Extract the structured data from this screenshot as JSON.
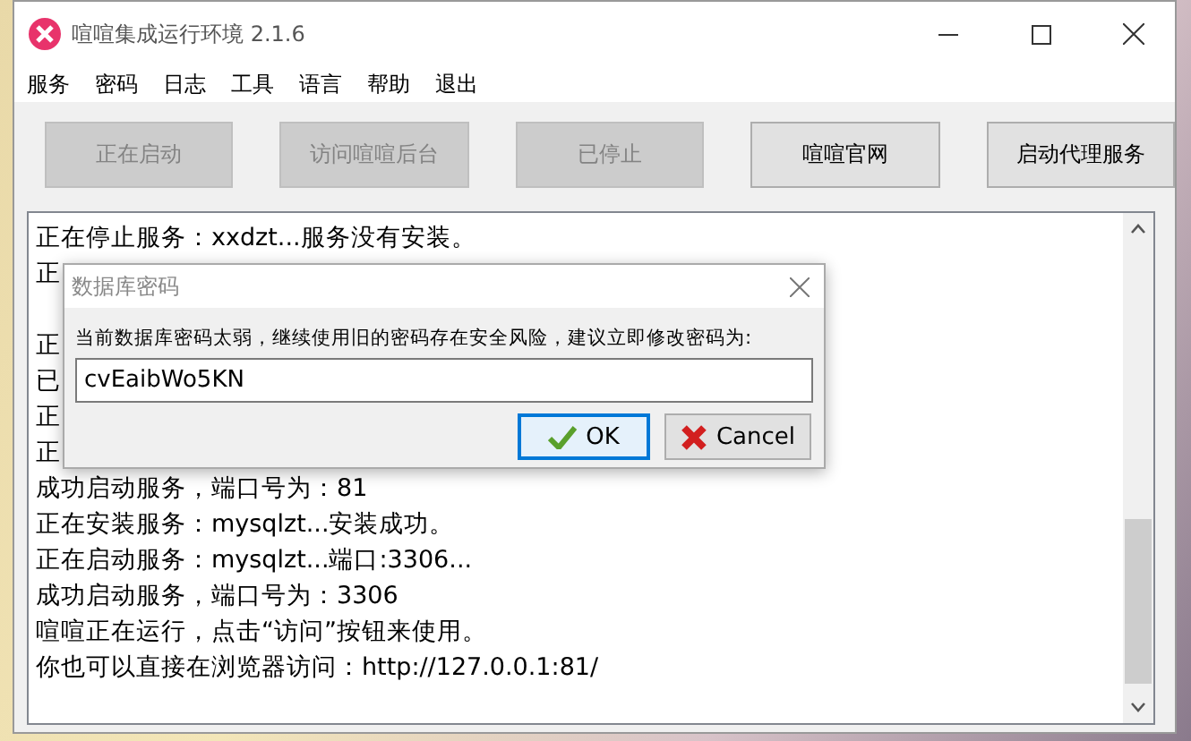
{
  "window": {
    "title": "喧喧集成运行环境 2.1.6"
  },
  "menu": [
    {
      "label": "服务"
    },
    {
      "label": "密码"
    },
    {
      "label": "日志"
    },
    {
      "label": "工具"
    },
    {
      "label": "语言"
    },
    {
      "label": "帮助"
    },
    {
      "label": "退出"
    }
  ],
  "toolbar": [
    {
      "label": "正在启动",
      "disabled": true
    },
    {
      "label": "访问喧喧后台",
      "disabled": true
    },
    {
      "label": "已停止",
      "disabled": true
    },
    {
      "label": "喧喧官网",
      "disabled": false
    },
    {
      "label": "启动代理服务",
      "disabled": false
    }
  ],
  "log": [
    {
      "kind": "text",
      "text": "正在停止服务：xxdzt...服务没有安装。"
    },
    {
      "kind": "text",
      "text": "正"
    },
    {
      "kind": "blank"
    },
    {
      "kind": "text",
      "text": "正"
    },
    {
      "kind": "text",
      "text": "已"
    },
    {
      "kind": "text",
      "text": "正"
    },
    {
      "kind": "text",
      "text": "正"
    },
    {
      "kind": "text",
      "text": "成功启动服务，端口号为：81"
    },
    {
      "kind": "text",
      "text": "正在安装服务：mysqlzt...安装成功。"
    },
    {
      "kind": "text",
      "text": "正在启动服务：mysqlzt...端口:3306..."
    },
    {
      "kind": "text",
      "text": "成功启动服务，端口号为：3306"
    },
    {
      "kind": "text",
      "text": "喧喧正在运行，点击“访问”按钮来使用。"
    },
    {
      "kind": "text",
      "text": "你也可以直接在浏览器访问：http://127.0.0.1:81/"
    }
  ],
  "dialog": {
    "title": "数据库密码",
    "message": "当前数据库密码太弱，继续使用旧的密码存在安全风险，建议立即修改密码为:",
    "value": "cvEaibWo5KN",
    "buttons": [
      {
        "kind": "ok",
        "label": "OK",
        "focused": true
      },
      {
        "kind": "cancel",
        "label": "Cancel",
        "focused": false
      }
    ]
  }
}
